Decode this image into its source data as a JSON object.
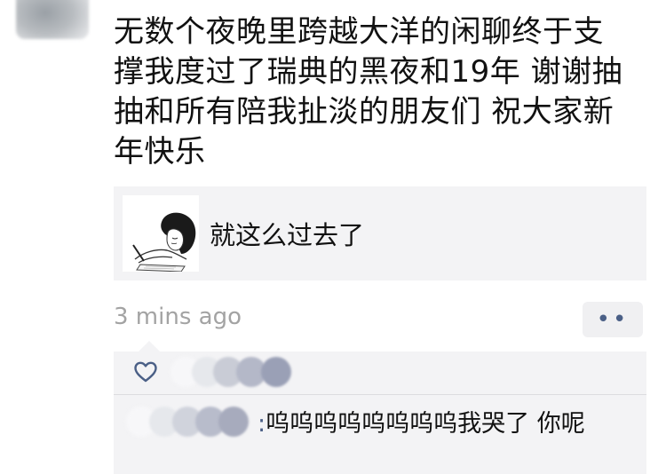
{
  "post": {
    "lines": [
      "无数个夜晚里跨越大洋的闲聊终于支",
      "撑我度过了瑞典的黑夜和19年 谢谢抽",
      "抽和所有陪我扯淡的朋友们 祝大家新",
      "年快乐"
    ]
  },
  "share": {
    "title": "就这么过去了",
    "thumb_icon": "sleeping-girl-sketch-icon"
  },
  "meta": {
    "timestamp": "3 mins ago",
    "more_label": "••"
  },
  "likes": {
    "icon": "heart-outline-icon"
  },
  "comment": {
    "separator": ":",
    "text": "呜呜呜呜呜呜呜呜我哭了 你呢"
  },
  "colors": {
    "link_blue": "#4a5f86",
    "card_bg": "#f3f3f5",
    "timestamp_gray": "#a3a3a3"
  }
}
